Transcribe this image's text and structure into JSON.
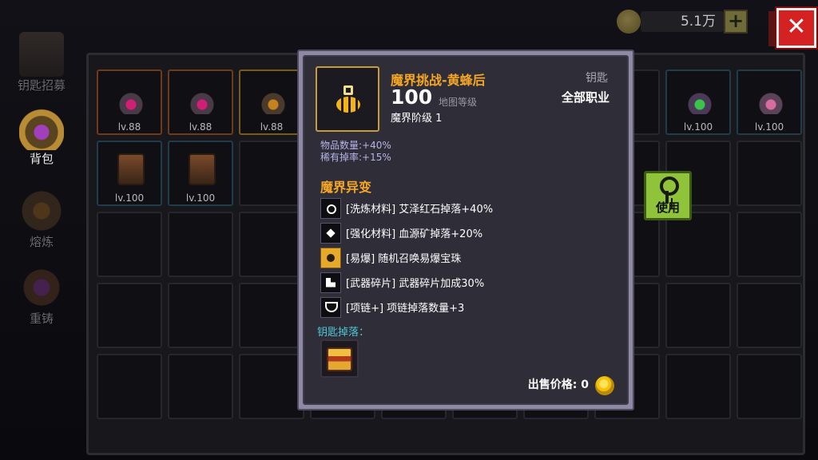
{
  "nav": {
    "keys_recruit": "钥匙招募",
    "backpack": "背包",
    "smelt": "熔炼",
    "reforge": "重铸"
  },
  "currency": {
    "amount": "5.1万",
    "plus_label": "+",
    "close_label": "✕"
  },
  "inventory": {
    "slots": [
      {
        "lv": "lv.88",
        "style": "orange",
        "item": "k-purple"
      },
      {
        "lv": "lv.88",
        "style": "orange",
        "item": "k-purple"
      },
      {
        "lv": "lv.88",
        "style": "gold",
        "item": "k-gold"
      },
      {
        "lv": "lv.100",
        "style": "cyan",
        "item": "k-green"
      },
      {
        "lv": "lv.100",
        "style": "cyan",
        "item": "k-pink"
      },
      {
        "lv": "lv.100",
        "style": "cyan",
        "item": "k-tower"
      },
      {
        "lv": "lv.100",
        "style": "cyan",
        "item": "k-tower"
      }
    ]
  },
  "use_button": {
    "label": "使用"
  },
  "tooltip": {
    "title": "魔界挑战-黄蜂后",
    "level": "100",
    "level_label": "地图等级",
    "tier": "魔界阶级 1",
    "type": "钥匙",
    "classes": "全部职业",
    "stats": [
      "物品数量:+40%",
      "稀有掉率:+15%"
    ],
    "mutations_title": "魔界异变",
    "mutations": [
      {
        "icon": "refine",
        "text": "[洗炼材料] 艾泽红石掉落+40%"
      },
      {
        "icon": "enhance",
        "text": "[强化材料] 血源矿掉落+20%"
      },
      {
        "icon": "explode",
        "text": "[易爆] 随机召唤易爆宝珠"
      },
      {
        "icon": "shard",
        "text": "[武器碎片] 武器碎片加成30%"
      },
      {
        "icon": "necklace",
        "text": "[项链+] 项链掉落数量+3"
      }
    ],
    "drop_title": "钥匙掉落：",
    "sell_price": "出售价格: 0"
  },
  "colors": {
    "accent_orange": "#f5a623",
    "use_green": "#8fc43a",
    "close_red": "#d42121",
    "drop_cyan": "#4fc7d8"
  }
}
